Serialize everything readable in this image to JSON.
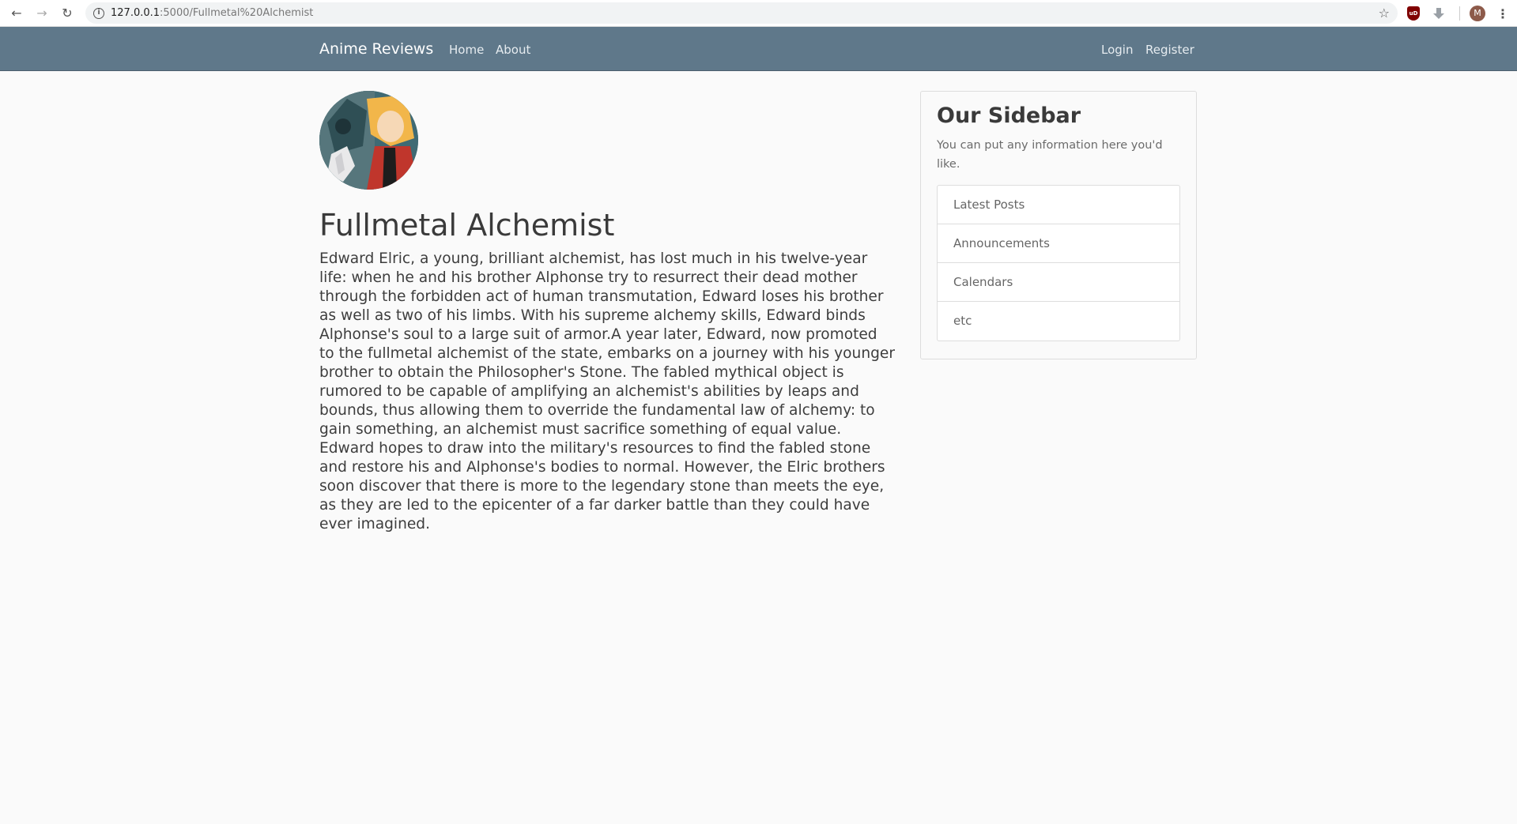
{
  "browser": {
    "url_host": "127.0.0.1",
    "url_path": ":5000/Fullmetal%20Alchemist",
    "avatar_letter": "M",
    "ext_label": "uD"
  },
  "navbar": {
    "brand": "Anime Reviews",
    "links": [
      "Home",
      "About"
    ],
    "right_links": [
      "Login",
      "Register"
    ],
    "background_color": "#5f788a"
  },
  "main": {
    "title": "Fullmetal Alchemist",
    "description": "Edward Elric, a young, brilliant alchemist, has lost much in his twelve-year life: when he and his brother Alphonse try to resurrect their dead mother through the forbidden act of human transmutation, Edward loses his brother as well as two of his limbs. With his supreme alchemy skills, Edward binds Alphonse's soul to a large suit of armor.A year later, Edward, now promoted to the fullmetal alchemist of the state, embarks on a journey with his younger brother to obtain the Philosopher's Stone. The fabled mythical object is rumored to be capable of amplifying an alchemist's abilities by leaps and bounds, thus allowing them to override the fundamental law of alchemy: to gain something, an alchemist must sacrifice something of equal value. Edward hopes to draw into the military's resources to find the fabled stone and restore his and Alphonse's bodies to normal. However, the Elric brothers soon discover that there is more to the legendary stone than meets the eye, as they are led to the epicenter of a far darker battle than they could have ever imagined."
  },
  "sidebar": {
    "title": "Our Sidebar",
    "text": "You can put any information here you'd like.",
    "items": [
      "Latest Posts",
      "Announcements",
      "Calendars",
      "etc"
    ]
  }
}
